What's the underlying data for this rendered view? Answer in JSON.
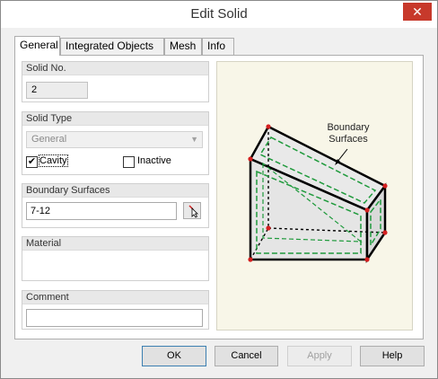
{
  "window": {
    "title": "Edit Solid",
    "close_glyph": "✕"
  },
  "tabs": [
    {
      "label": "General",
      "active": true
    },
    {
      "label": "Integrated Objects",
      "active": false
    },
    {
      "label": "Mesh",
      "active": false
    },
    {
      "label": "Info",
      "active": false
    }
  ],
  "general": {
    "solid_no": {
      "label": "Solid No.",
      "value": "2"
    },
    "solid_type": {
      "label": "Solid Type",
      "value": "General",
      "cavity": {
        "label": "Cavity",
        "checked": true
      },
      "inactive": {
        "label": "Inactive",
        "checked": false
      }
    },
    "boundary_surfaces": {
      "label": "Boundary Surfaces",
      "value": "7-12",
      "pick_icon": "cursor-pick-icon"
    },
    "material": {
      "label": "Material"
    },
    "comment": {
      "label": "Comment",
      "value": ""
    }
  },
  "illustration": {
    "annotation_line1": "Boundary",
    "annotation_line2": "Surfaces"
  },
  "buttons": {
    "ok": "OK",
    "cancel": "Cancel",
    "apply": "Apply",
    "help": "Help"
  },
  "colors": {
    "dashed_surface": "#1f9a3c",
    "vertex": "#d42020",
    "close_button": "#c7392b"
  }
}
